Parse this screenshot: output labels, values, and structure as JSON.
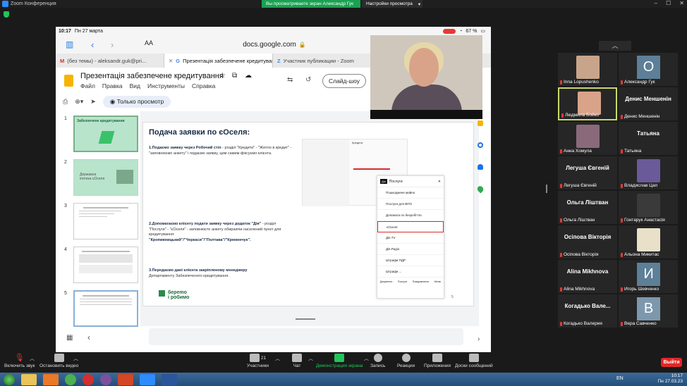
{
  "window": {
    "title": "Zoom Конференция"
  },
  "share_banner": {
    "text": "Вы просматриваете экран Александр Гук",
    "view_options": "Настройки просмотра"
  },
  "ipad": {
    "time": "10:17",
    "date": "Пн 27 марта",
    "battery": "67 %"
  },
  "safari": {
    "aa": "AA",
    "url": "docs.google.com"
  },
  "browser_tabs": [
    {
      "label": "(без темы) - aleksandr.guk@pri..."
    },
    {
      "label": "Презентація забезпечене кредитування"
    },
    {
      "label": "Участник публикации - Zoom"
    }
  ],
  "slides_app": {
    "title": "Презентація забезпечене кредитування",
    "menu": [
      "Файл",
      "Правка",
      "Вид",
      "Инструменты",
      "Справка"
    ],
    "slideshow_label": "Слайд-шоу",
    "view_only_label": "Только просмотр"
  },
  "thumbnails": [
    {
      "num": "1",
      "text": "Забезпечене кредитування"
    },
    {
      "num": "2",
      "text": "Державна іпотека єОселя"
    },
    {
      "num": "3",
      "text": ""
    },
    {
      "num": "4",
      "text": ""
    },
    {
      "num": "5",
      "text": ""
    }
  ],
  "slide": {
    "title": "Подача заявки по єОселя:",
    "p1_bold": "1.Подаємо заявку через Робочий стіл",
    "p1_text": " - розділ \"Кредити\" - \"Житло в кредит\" - \"заповнюємо анкету\" і подаємо заявку, цим самим фіксуємо клієнта.",
    "p2_bold": "2.Допомагаємо клієнту подати заявку через додаток \"Дія\"",
    "p2_text": " - розділ \"Послуги\" - \"єОселя\" - заповнюєте анкету обираючи населений пункт для кредитування:",
    "p2_cities": "\"Кропивницький\"/\"Черкаси\"/\"Полтава\"/\"Кременчук\".",
    "p3_bold": "3.Передаємо дані клієнта закріпленому менеджеру",
    "p3_text": "Департаменту Забезпеченого кредитування.",
    "logo_line1": "берemo",
    "logo_line2": "і робимо",
    "ss_credits_label": "Кредити",
    "diia_header": "Послуги",
    "diia_items": [
      "Пошкоджене майно",
      "Послуги для ВПО",
      "Допомога по безробіттю",
      "єОселя",
      "Дія.TV",
      "Дія.Радіо",
      "Штрафи ПДР",
      "Штрафи ..."
    ],
    "diia_nav": [
      "Документи",
      "Послуги",
      "Повідомлення",
      "Меню"
    ],
    "page_number": "5"
  },
  "gallery": [
    {
      "name": "Inna Lopushenko",
      "type": "photo",
      "color": "#c8a58a"
    },
    {
      "name": "Александр Гук",
      "type": "avatar",
      "letter": "О",
      "color": "#5d7f98"
    },
    {
      "name": "Людмила Бойко",
      "type": "photo",
      "color": "#d9a38a",
      "highlight": true
    },
    {
      "name": "Денис Меншенін",
      "type": "text",
      "big": "Денис Меншенін"
    },
    {
      "name": "Анна Хомула",
      "type": "photo",
      "color": "#8a6a7a"
    },
    {
      "name": "Татьяна",
      "type": "text",
      "big": "Татьяна"
    },
    {
      "name": "Легуша Євгеній",
      "type": "text",
      "big": "Легуша Євгеній"
    },
    {
      "name": "Владислав Цап",
      "type": "photo",
      "color": "#6a5a9a"
    },
    {
      "name": "Ольга Ліштван",
      "type": "text",
      "big": "Ольга Ліштван"
    },
    {
      "name": "Гонтарук Анастасія",
      "type": "photo",
      "color": "#3a3a3a"
    },
    {
      "name": "Осіпова Вікторія",
      "type": "text",
      "big": "Осіпова Вікторія"
    },
    {
      "name": "Альона Микитас",
      "type": "photo",
      "color": "#e8e0c8"
    },
    {
      "name": "Alina Mikhnova",
      "type": "text",
      "big": "Alina Mikhnova"
    },
    {
      "name": "Игорь Шевченко",
      "type": "avatar",
      "letter": "И",
      "color": "#5d7f98"
    },
    {
      "name": "Когадько Вале...",
      "type": "text",
      "big": "Когадько Вале...",
      "label": "Когадько Валерия"
    },
    {
      "name": "Вера Савченко",
      "type": "avatar",
      "letter": "В",
      "color": "#7d98ad"
    }
  ],
  "controls": [
    {
      "label": "Включить звук"
    },
    {
      "label": "Остановить видео"
    },
    {
      "label": "Участники",
      "count": "21"
    },
    {
      "label": "Чат"
    },
    {
      "label": "Демонстрация экрана"
    },
    {
      "label": "Запись"
    },
    {
      "label": "Реакции"
    },
    {
      "label": "Приложения"
    },
    {
      "label": "Доски сообщений"
    }
  ],
  "leave_label": "Выйти",
  "tray": {
    "lang": "EN",
    "time": "10:17",
    "date": "Пн 27.03.23"
  }
}
